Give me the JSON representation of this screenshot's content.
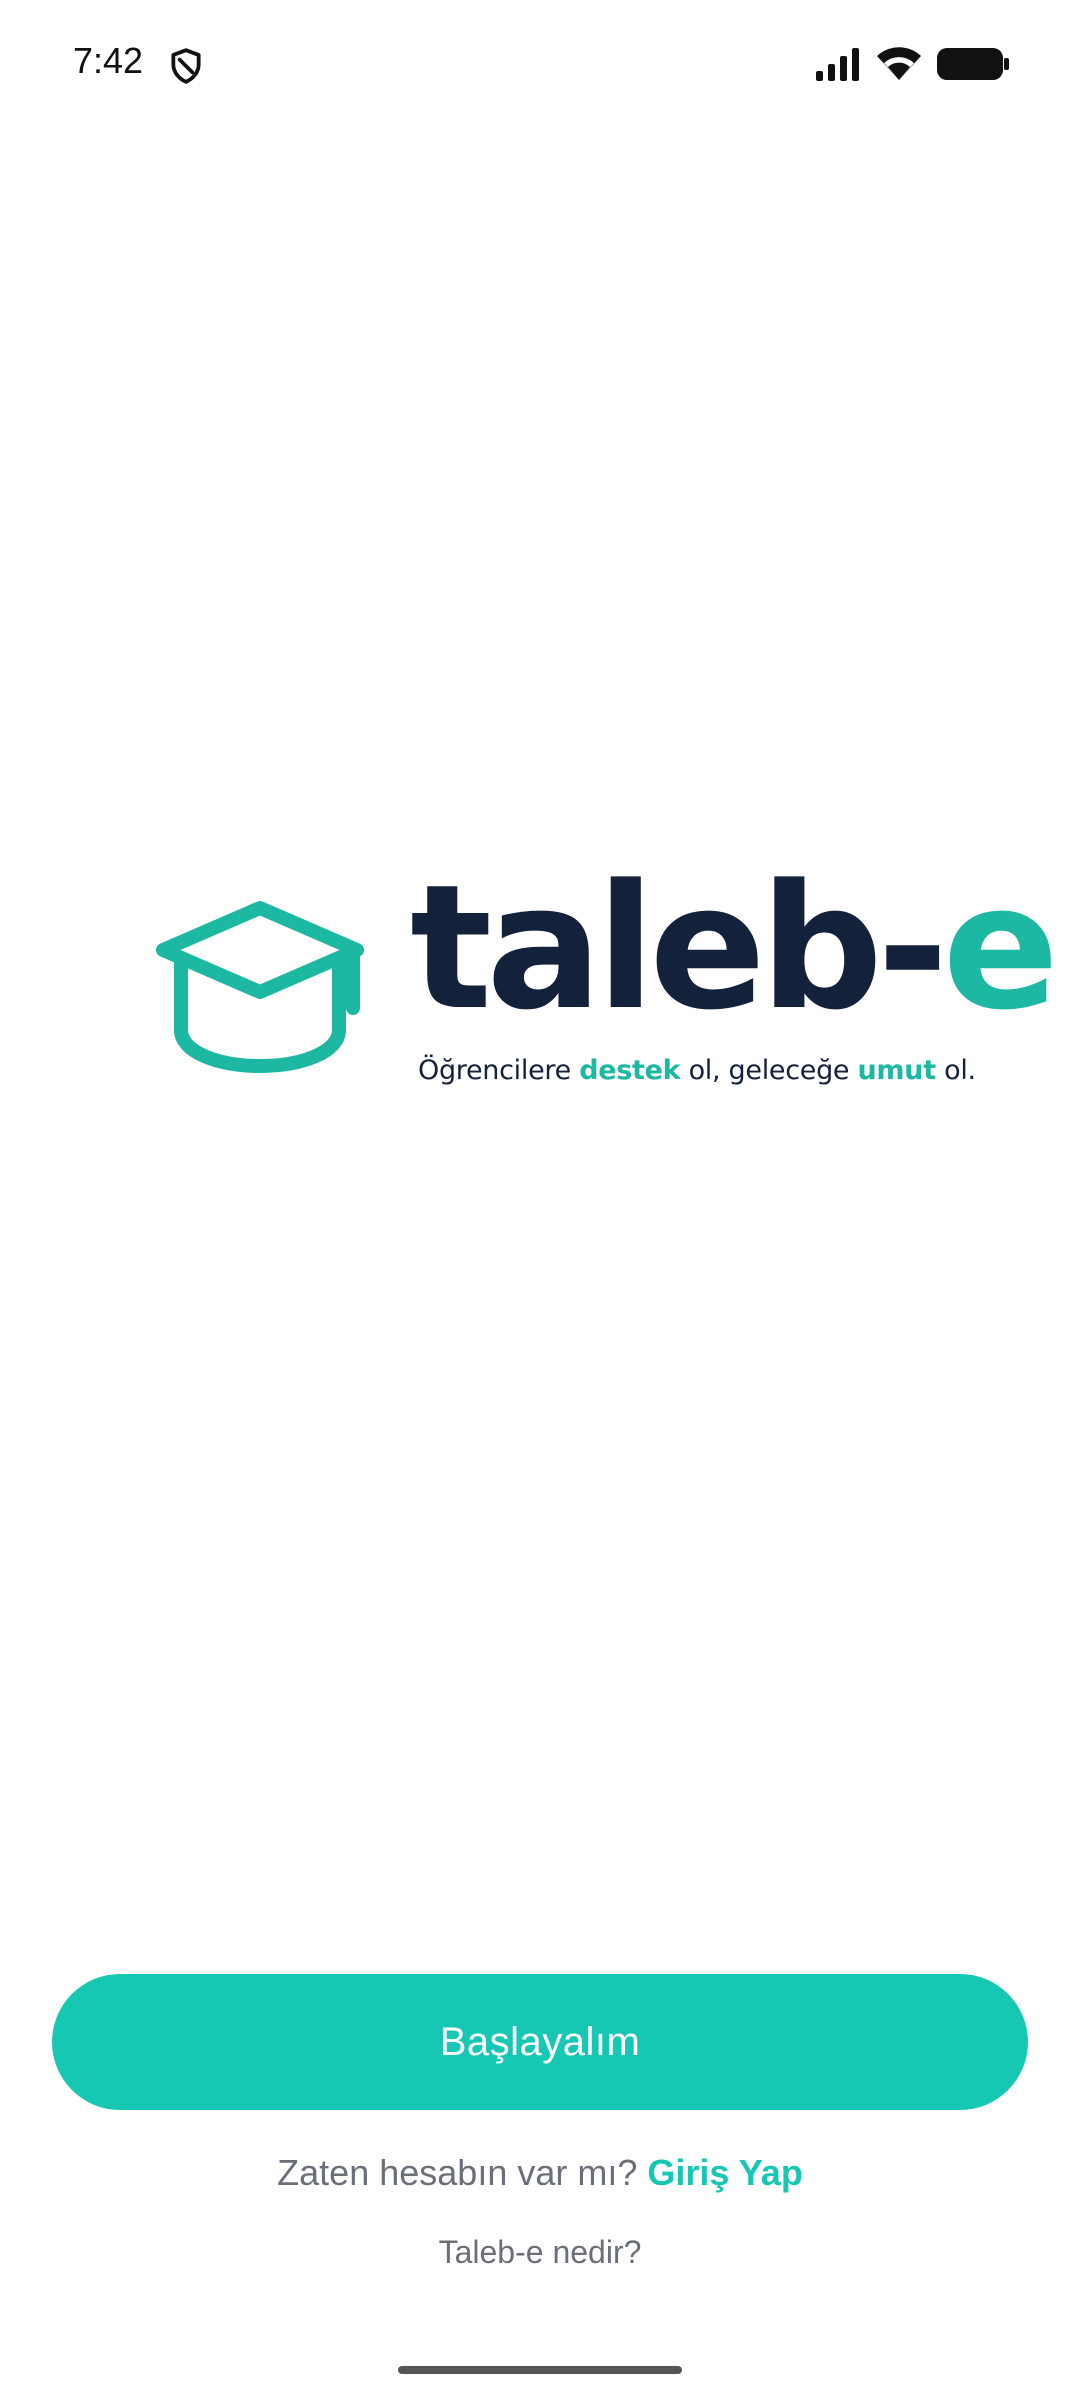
{
  "status_bar": {
    "time": "7:42",
    "icons": [
      "shield-icon",
      "signal-icon",
      "wifi-icon",
      "battery-icon"
    ]
  },
  "logo": {
    "brand_main": "taleb-",
    "brand_accent": "e",
    "tagline": {
      "part1": "Öğrencilere ",
      "highlight1": "destek",
      "part2": " ol, geleceğe ",
      "highlight2": "umut",
      "part3": " ol."
    },
    "icon": "graduation-cap-icon"
  },
  "actions": {
    "start_label": "Başlayalım",
    "login_prompt": "Zaten hesabın var mı?",
    "login_link": "Giriş Yap",
    "whatis_link": "Taleb-e nedir?"
  },
  "colors": {
    "accent": "#16c8b4",
    "brand_dark": "#14213a",
    "muted_text": "#6b6f7a"
  }
}
